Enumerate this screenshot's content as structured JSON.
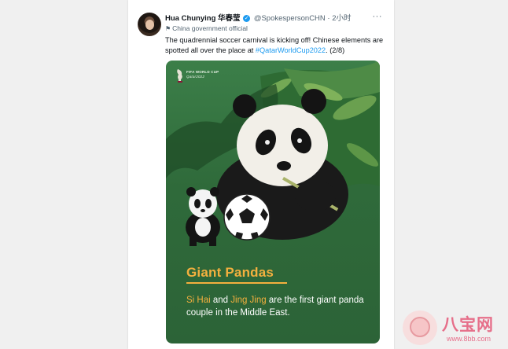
{
  "tweet": {
    "author_name": "Hua Chunying 华春莹",
    "handle": "@SpokespersonCHN",
    "separator": "·",
    "time": "2小时",
    "more": "···",
    "label": "China government official",
    "text_before": "The quadrennial soccer carnival is kicking off! Chinese elements are spotted all over the place at ",
    "hashtag": "#QatarWorldCup2022",
    "text_after": ". (2/8)"
  },
  "media": {
    "logo_line1": "FIFA WORLD CUP",
    "logo_line2": "Qatar2022",
    "title": "Giant Pandas",
    "name1": "Si Hai",
    "and": " and ",
    "name2": "Jing Jing",
    "rest": " are the first giant panda couple in the Middle East."
  },
  "watermark": {
    "name": "八宝网",
    "url": "www.8bb.com"
  },
  "colors": {
    "accent": "#1d9bf0",
    "poster_green": "#2f6a3a",
    "highlight": "#f4b03e"
  },
  "icons": [
    "verified-badge-icon",
    "government-flag-icon",
    "more-icon",
    "fifa-trophy-icon",
    "soccer-ball-icon"
  ]
}
